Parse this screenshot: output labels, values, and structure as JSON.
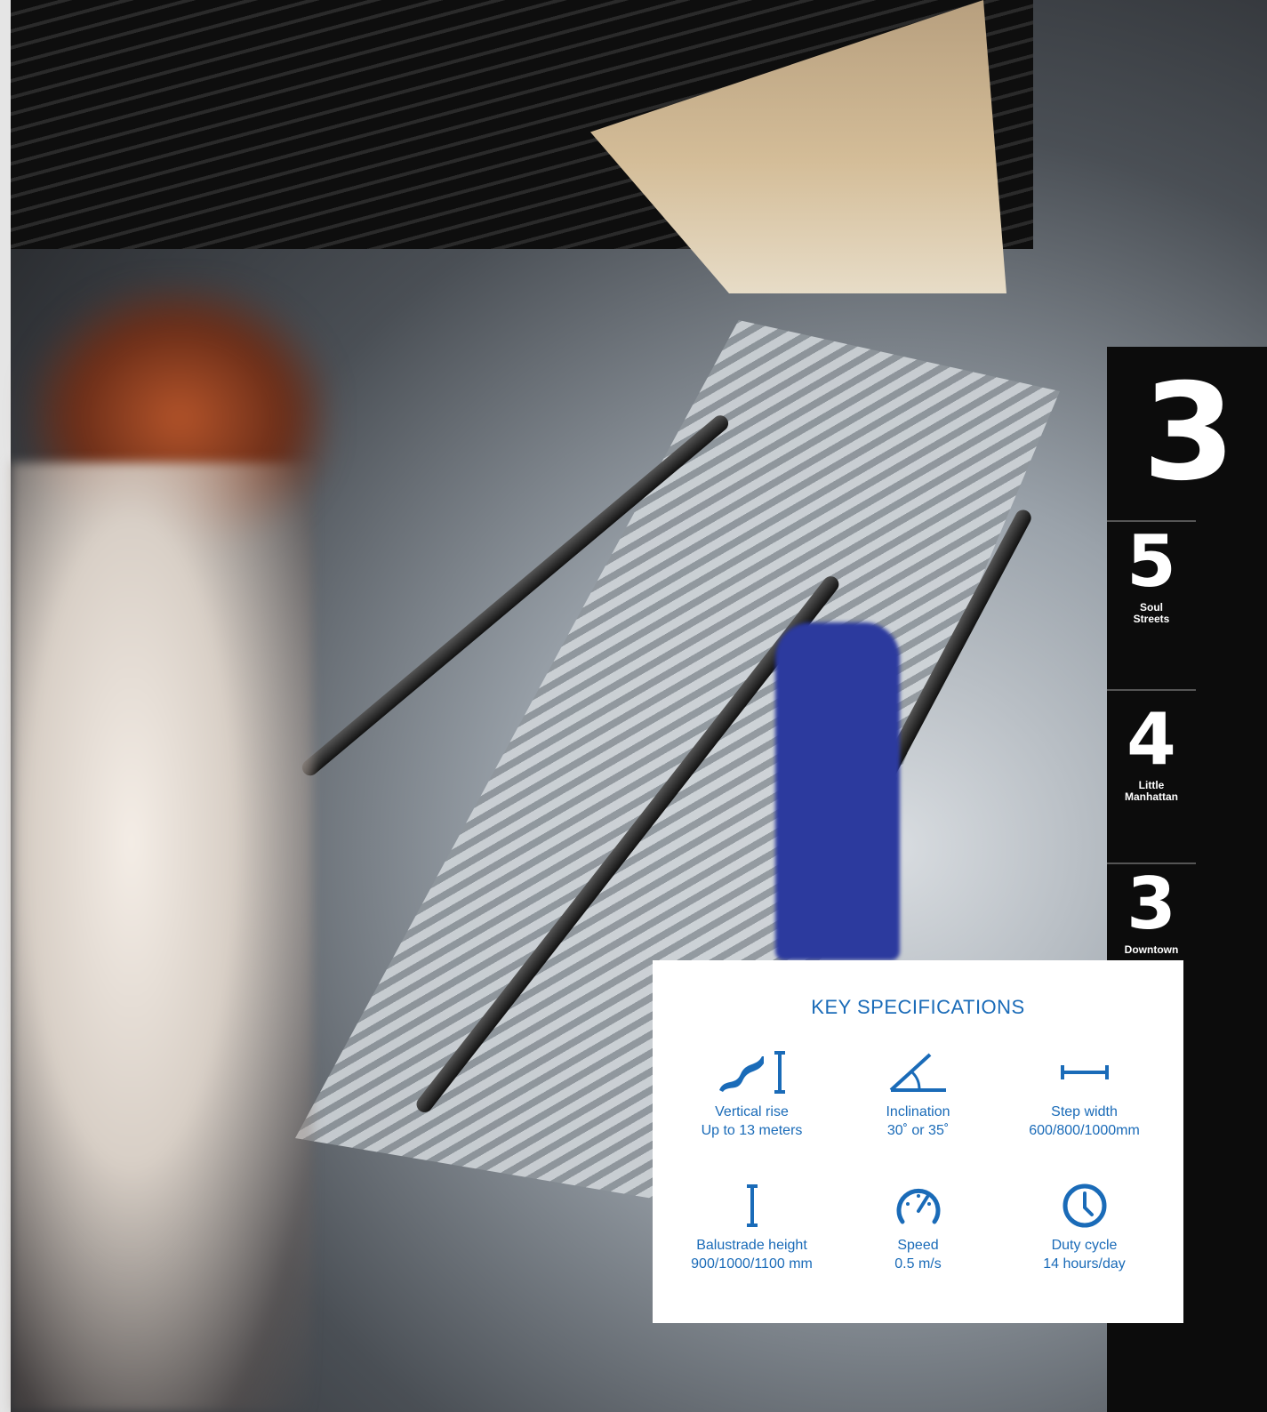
{
  "signage": {
    "current_level": "3",
    "levels": [
      {
        "number": "5",
        "name": "Soul Streets"
      },
      {
        "number": "4",
        "name": "Little Manhattan"
      },
      {
        "number": "3",
        "name": "Downtown"
      }
    ]
  },
  "specs": {
    "title": "KEY SPECIFICATIONS",
    "accent_color": "#1a6bb8",
    "items": [
      {
        "icon": "vertical-rise-icon",
        "label": "Vertical rise",
        "value": "Up to 13 meters"
      },
      {
        "icon": "inclination-icon",
        "label": "Inclination",
        "value": "30˚ or 35˚"
      },
      {
        "icon": "step-width-icon",
        "label": "Step width",
        "value": "600/800/1000mm"
      },
      {
        "icon": "balustrade-height-icon",
        "label": "Balustrade height",
        "value": "900/1000/1100 mm"
      },
      {
        "icon": "speed-gauge-icon",
        "label": "Speed",
        "value": "0.5 m/s"
      },
      {
        "icon": "clock-icon",
        "label": "Duty cycle",
        "value": "14 hours/day"
      }
    ]
  }
}
